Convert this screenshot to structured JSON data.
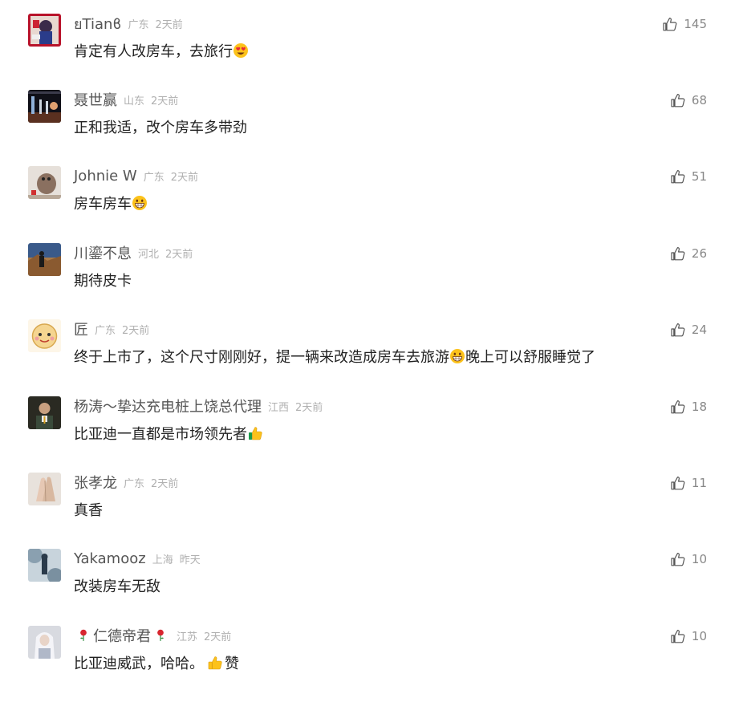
{
  "comments": [
    {
      "username": "ยTianϐ",
      "location": "广东",
      "time": "2天前",
      "text": "肯定有人改房车，去旅行",
      "likes": "145",
      "avatar_icon": "anime-avatar-icon",
      "trailing_emoji": "heart-eyes-emoji"
    },
    {
      "username": "聂世赢",
      "location": "山东",
      "time": "2天前",
      "text": "正和我适，改个房车多带劲",
      "likes": "68",
      "avatar_icon": "stage-avatar-icon"
    },
    {
      "username": "Johnie W",
      "location": "广东",
      "time": "2天前",
      "text": "房车房车",
      "likes": "51",
      "avatar_icon": "bird-avatar-icon",
      "trailing_emoji": "grinning-emoji"
    },
    {
      "username": "川鎏不息",
      "location": "河北",
      "time": "2天前",
      "text": "期待皮卡",
      "likes": "26",
      "avatar_icon": "desert-avatar-icon"
    },
    {
      "username": "匠",
      "location": "广东",
      "time": "2天前",
      "text_before": "终于上市了，这个尺寸刚刚好，提一辆来改造成房车去旅游",
      "text_after": "晚上可以舒服睡觉了",
      "likes": "24",
      "avatar_icon": "cartoon-face-avatar-icon",
      "inline_emoji": "grinning-emoji"
    },
    {
      "username": "杨涛～挚达充电桩上饶总代理",
      "location": "江西",
      "time": "2天前",
      "text": "比亚迪一直都是市场领先者",
      "likes": "18",
      "avatar_icon": "man-portrait-avatar-icon",
      "trailing_emoji": "thumbs-up-emoji"
    },
    {
      "username": "张孝龙",
      "location": "广东",
      "time": "2天前",
      "text": "真香",
      "likes": "11",
      "avatar_icon": "praying-hands-avatar-icon"
    },
    {
      "username": "Yakamooz",
      "location": "上海",
      "time": "昨天",
      "text": "改装房车无敌",
      "likes": "10",
      "avatar_icon": "ink-painting-avatar-icon"
    },
    {
      "username": "仁德帝君",
      "location": "江苏",
      "time": "2天前",
      "text_before": "比亚迪威武，哈哈。",
      "text_after": "赞",
      "likes": "10",
      "avatar_icon": "white-hair-avatar-icon",
      "name_decoration": "rose-icon",
      "inline_emoji": "thumbs-up-emoji"
    }
  ],
  "colors": {
    "username": "#555555",
    "meta": "#b0b0b0",
    "text": "#222222",
    "like_count": "#888888"
  }
}
